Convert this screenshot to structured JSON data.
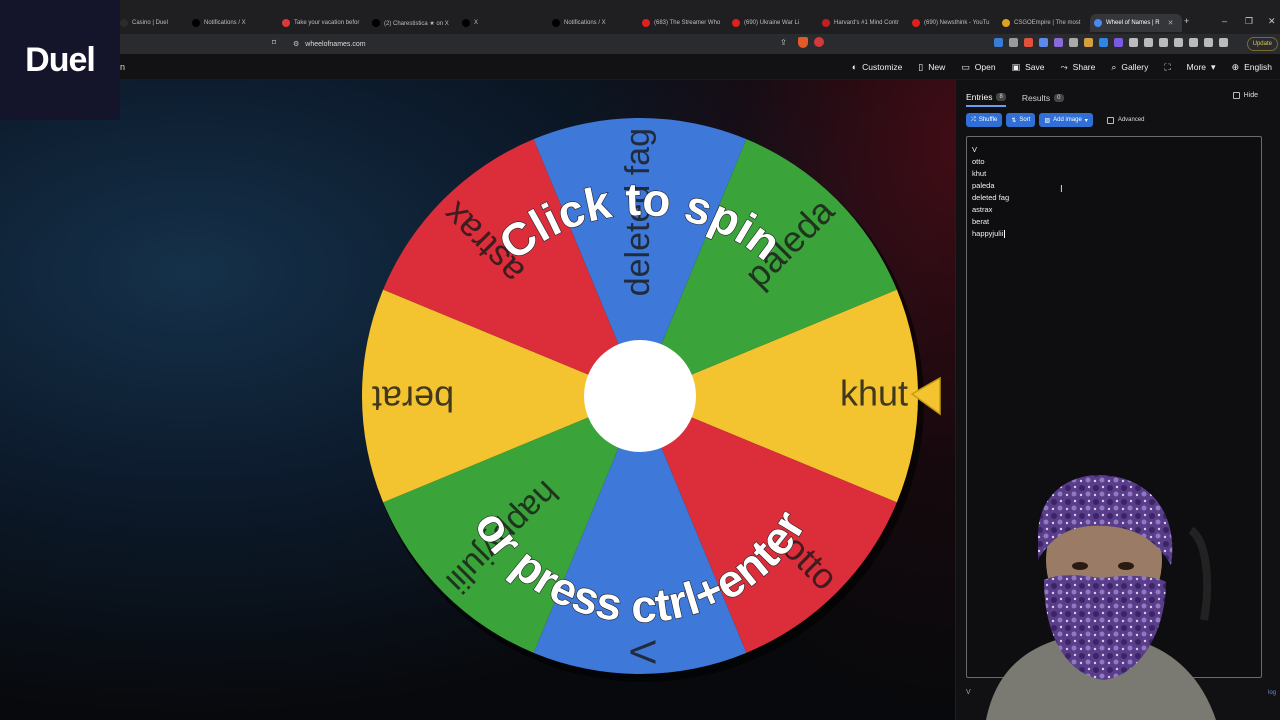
{
  "browser": {
    "tabs": [
      {
        "label": "Casino | Duel",
        "favicon_color": "#2b2b2b",
        "icon": "casino-favicon",
        "active": false
      },
      {
        "label": "Notifications / X",
        "favicon_color": "#000000",
        "icon": "x-logo-icon",
        "active": false
      },
      {
        "label": "Take your vacation befor",
        "favicon_color": "#d83a3a",
        "icon": "vacation-favicon",
        "active": false
      },
      {
        "label": "(2) Charestistica ★ on X",
        "favicon_color": "#000000",
        "icon": "x-logo-icon",
        "active": false
      },
      {
        "label": "X",
        "favicon_color": "#000000",
        "icon": "x-logo-icon",
        "active": false
      },
      {
        "label": "Notifications / X",
        "favicon_color": "#000000",
        "icon": "x-logo-icon",
        "active": false
      },
      {
        "label": "(683) The Streamer Who",
        "favicon_color": "#e02020",
        "icon": "youtube-icon",
        "active": false
      },
      {
        "label": "(690) Ukraine War Li",
        "favicon_color": "#e02020",
        "icon": "youtube-icon",
        "active": false
      },
      {
        "label": "Harvard's #1 Mind Contr",
        "favicon_color": "#c02020",
        "icon": "harvard-favicon",
        "active": false
      },
      {
        "label": "(690) Newsthink - YouTu",
        "favicon_color": "#e02020",
        "icon": "youtube-icon",
        "active": false
      },
      {
        "label": "CSGOEmpire | The most",
        "favicon_color": "#e0a020",
        "icon": "csgoempire-favicon",
        "active": false
      },
      {
        "label": "Wheel of Names | R",
        "favicon_color": "#4a8af0",
        "icon": "wheel-favicon",
        "active": true
      }
    ],
    "new_tab_glyph": "+",
    "window_controls": {
      "minimize": "–",
      "maximize": "❐",
      "close": "✕"
    },
    "url": "wheelofnames.com",
    "update_label": "Update",
    "extension_colors": [
      "#3a7bd5",
      "#9a9a9a",
      "#e0503a",
      "#5c8ae6",
      "#8a6ad8",
      "#aaaaaa",
      "#d5a040",
      "#2f86e0",
      "#7a5ae0",
      "#bbbbbb",
      "#bbbbbb",
      "#bbbbbb",
      "#bbbbbb",
      "#bbbbbb",
      "#bbbbbb",
      "#bbbbbb"
    ]
  },
  "overlay": {
    "logo_text": "Duel"
  },
  "toolbar": {
    "partial_label": "n",
    "items": [
      {
        "label": "Customize",
        "icon": "palette-icon",
        "glyph": "◐"
      },
      {
        "label": "New",
        "icon": "file-icon",
        "glyph": "▯"
      },
      {
        "label": "Open",
        "icon": "folder-icon",
        "glyph": "▭"
      },
      {
        "label": "Save",
        "icon": "save-icon",
        "glyph": "▣"
      },
      {
        "label": "Share",
        "icon": "share-icon",
        "glyph": "⤳"
      },
      {
        "label": "Gallery",
        "icon": "search-icon",
        "glyph": "⌕"
      },
      {
        "label": "",
        "icon": "fullscreen-icon",
        "glyph": "⛶"
      },
      {
        "label": "More",
        "icon": "chevron-down-icon",
        "glyph": "▾"
      },
      {
        "label": "English",
        "icon": "globe-icon",
        "glyph": "⊕"
      }
    ]
  },
  "wheel": {
    "overlay_text_top": "Click to spin",
    "overlay_text_bottom": "or press ctrl+enter",
    "segments": [
      {
        "label": "khut",
        "color": "#f4c430"
      },
      {
        "label": "otto",
        "color": "#db2e3a"
      },
      {
        "label": "V",
        "color": "#3e78d8"
      },
      {
        "label": "happyjulii",
        "color": "#3aa43a"
      },
      {
        "label": "berat",
        "color": "#f4c430"
      },
      {
        "label": "astrax",
        "color": "#db2e3a"
      },
      {
        "label": "deleted fag",
        "color": "#3e78d8"
      },
      {
        "label": "paleda",
        "color": "#3aa43a"
      }
    ],
    "pointer_color": "#f4c430"
  },
  "sidebar": {
    "tabs": [
      {
        "label": "Entries",
        "count": "8",
        "active": true
      },
      {
        "label": "Results",
        "count": "0",
        "active": false
      }
    ],
    "hide_label": "Hide",
    "buttons": [
      {
        "label": "Shuffle",
        "icon": "shuffle-icon",
        "glyph": "⤮"
      },
      {
        "label": "Sort",
        "icon": "sort-icon",
        "glyph": "⇅"
      },
      {
        "label": "Add image",
        "icon": "image-icon",
        "glyph": "▨"
      }
    ],
    "advanced_label": "Advanced",
    "entries": [
      "V",
      "otto",
      "khut",
      "paleda",
      "deleted fag",
      "astrax",
      "berat",
      "happyjulii"
    ],
    "bottom_left": "V",
    "bottom_right": "log"
  }
}
